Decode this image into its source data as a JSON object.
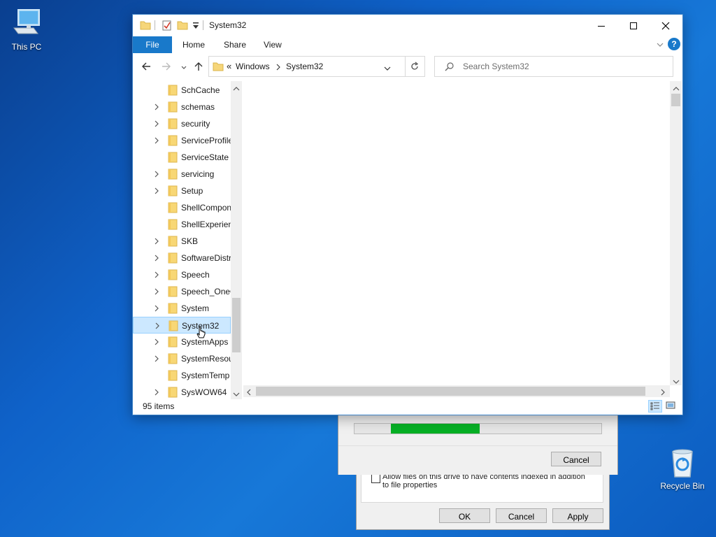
{
  "desktop": {
    "this_pc_label": "This PC",
    "recycle_bin_label": "Recycle Bin"
  },
  "back_dialog_format": {
    "checkbox_text": "Allow files on this drive to have contents indexed in addition to file properties",
    "ok_label": "OK",
    "cancel_label": "Cancel",
    "apply_label": "Apply"
  },
  "back_dialog_progress": {
    "progress_start": 0.147,
    "progress_end": 0.507,
    "cancel_label": "Cancel",
    "progress_color": "#06b025"
  },
  "explorer": {
    "title": "System32",
    "ribbon": {
      "file_label": "File",
      "tabs": [
        "Home",
        "Share",
        "View"
      ]
    },
    "address": {
      "overflow": "«",
      "crumbs": [
        "Windows",
        "System32"
      ]
    },
    "search_placeholder": "Search System32",
    "tree": [
      {
        "label": "SchCache",
        "expandable": false
      },
      {
        "label": "schemas",
        "expandable": true
      },
      {
        "label": "security",
        "expandable": true
      },
      {
        "label": "ServiceProfiles",
        "expandable": true
      },
      {
        "label": "ServiceState",
        "expandable": false
      },
      {
        "label": "servicing",
        "expandable": true
      },
      {
        "label": "Setup",
        "expandable": true
      },
      {
        "label": "ShellComponents",
        "expandable": false
      },
      {
        "label": "ShellExperiences",
        "expandable": false
      },
      {
        "label": "SKB",
        "expandable": true
      },
      {
        "label": "SoftwareDistribution",
        "expandable": true
      },
      {
        "label": "Speech",
        "expandable": true
      },
      {
        "label": "Speech_OneCore",
        "expandable": true
      },
      {
        "label": "System",
        "expandable": true
      },
      {
        "label": "System32",
        "expandable": true,
        "selected": true
      },
      {
        "label": "SystemApps",
        "expandable": true
      },
      {
        "label": "SystemResources",
        "expandable": true
      },
      {
        "label": "SystemTemp",
        "expandable": false
      },
      {
        "label": "SysWOW64",
        "expandable": true
      }
    ],
    "status_text": "95 items",
    "accent_color": "#1979ca"
  }
}
